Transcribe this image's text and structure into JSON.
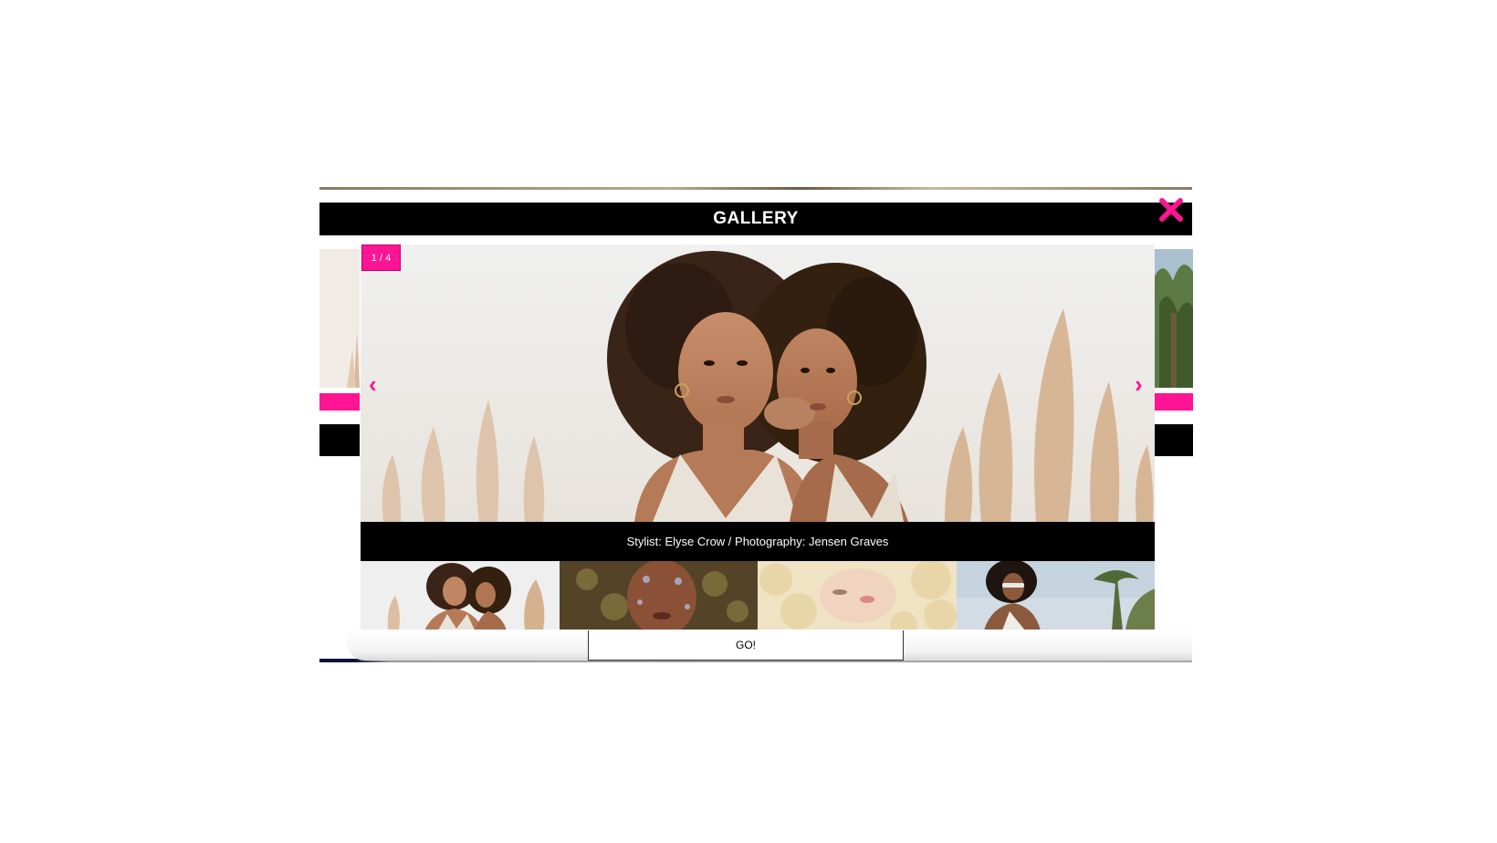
{
  "modal": {
    "title": "GALLERY",
    "close_icon": "close-x-icon",
    "accent_color": "#ff1493"
  },
  "slide": {
    "counter": "1 / 4",
    "prev_icon": "chevron-left-icon",
    "next_icon": "chevron-right-icon",
    "prev_glyph": "‹",
    "next_glyph": "›",
    "caption": "Stylist: Elyse Crow / Photography: Jensen Graves"
  },
  "thumbnails": [
    {
      "subject": "two women with curly hair"
    },
    {
      "subject": "face framed by greenery"
    },
    {
      "subject": "blonde curly hair profile"
    },
    {
      "subject": "woman with sunglasses outdoors"
    }
  ],
  "go_button": {
    "label": "GO!"
  }
}
